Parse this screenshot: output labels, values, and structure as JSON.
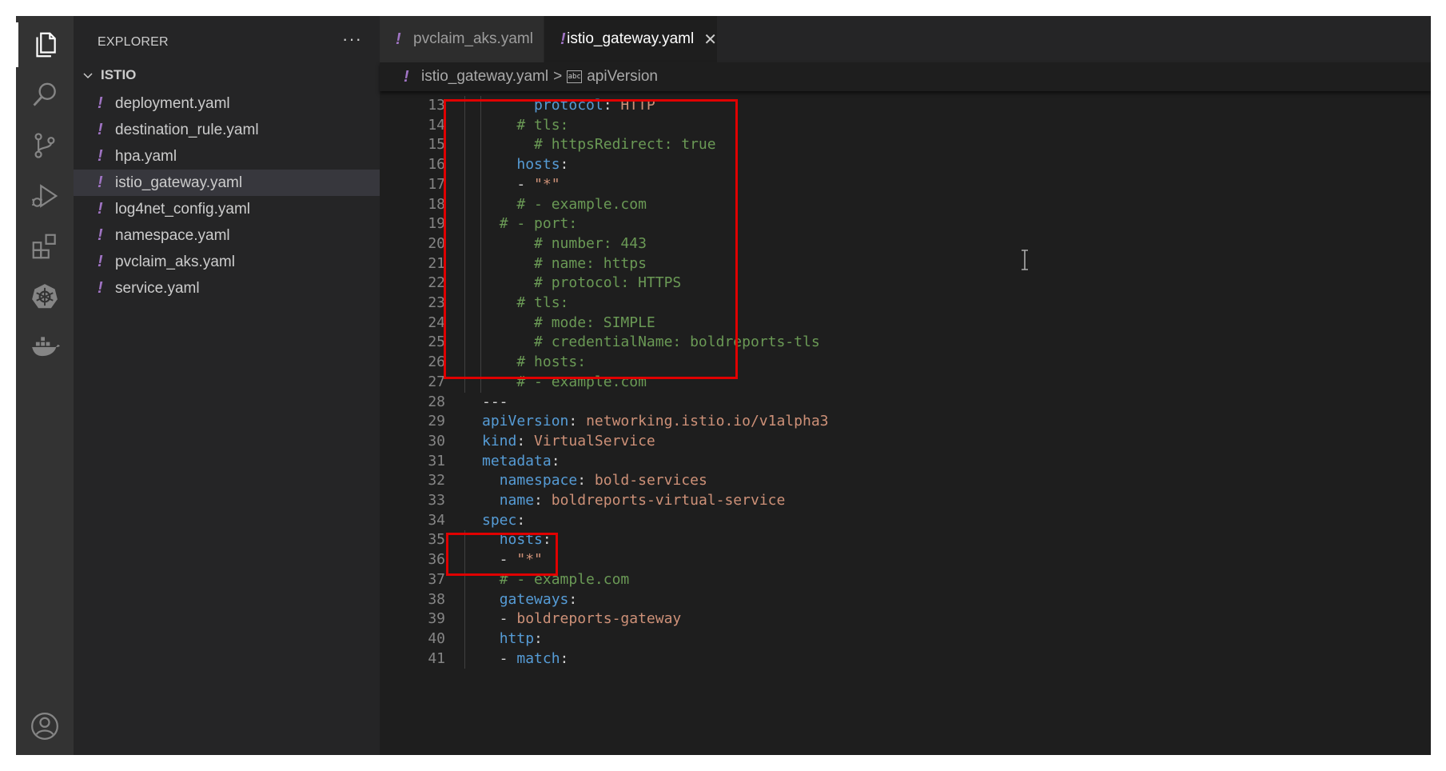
{
  "sidebar": {
    "title": "EXPLORER",
    "more": "···",
    "folder": "ISTIO",
    "files": [
      {
        "name": "deployment.yaml"
      },
      {
        "name": "destination_rule.yaml"
      },
      {
        "name": "hpa.yaml"
      },
      {
        "name": "istio_gateway.yaml",
        "selected": true
      },
      {
        "name": "log4net_config.yaml"
      },
      {
        "name": "namespace.yaml"
      },
      {
        "name": "pvclaim_aks.yaml"
      },
      {
        "name": "service.yaml"
      }
    ]
  },
  "activity_bar": [
    "files-icon",
    "search-icon",
    "source-control-icon",
    "run-debug-icon",
    "extensions-icon",
    "kubernetes-icon",
    "docker-icon",
    "account-icon"
  ],
  "tabs": [
    {
      "label": "pvclaim_aks.yaml",
      "active": false
    },
    {
      "label": "istio_gateway.yaml",
      "active": true,
      "close": "✕"
    }
  ],
  "breadcrumb": {
    "file": "istio_gateway.yaml",
    "separator": ">",
    "symbol_badge": "abc",
    "symbol": "apiVersion"
  },
  "file_icon_glyph": "!",
  "colors": {
    "keyword": "#569cd6",
    "string": "#ce9178",
    "comment": "#6a9955",
    "highlight_box": "#e00000",
    "yaml_icon": "#a074c4"
  },
  "editor": {
    "lines": [
      {
        "n": "13",
        "tokens": [
          [
            "p",
            "      "
          ],
          [
            "k",
            "protocol"
          ],
          [
            "p",
            ": "
          ],
          [
            "s",
            "HTTP"
          ]
        ]
      },
      {
        "n": "14",
        "tokens": [
          [
            "p",
            "    "
          ],
          [
            "c",
            "# tls:"
          ]
        ]
      },
      {
        "n": "15",
        "tokens": [
          [
            "p",
            "      "
          ],
          [
            "c",
            "# httpsRedirect: true"
          ]
        ]
      },
      {
        "n": "16",
        "tokens": [
          [
            "p",
            "    "
          ],
          [
            "k",
            "hosts"
          ],
          [
            "p",
            ":"
          ]
        ]
      },
      {
        "n": "17",
        "tokens": [
          [
            "p",
            "    - "
          ],
          [
            "s",
            "\"*\""
          ]
        ]
      },
      {
        "n": "18",
        "tokens": [
          [
            "p",
            "    "
          ],
          [
            "c",
            "# - example.com"
          ]
        ]
      },
      {
        "n": "19",
        "tokens": [
          [
            "p",
            "  "
          ],
          [
            "c",
            "# - port:"
          ]
        ]
      },
      {
        "n": "20",
        "tokens": [
          [
            "p",
            "      "
          ],
          [
            "c",
            "# number: 443"
          ]
        ]
      },
      {
        "n": "21",
        "tokens": [
          [
            "p",
            "      "
          ],
          [
            "c",
            "# name: https"
          ]
        ]
      },
      {
        "n": "22",
        "tokens": [
          [
            "p",
            "      "
          ],
          [
            "c",
            "# protocol: HTTPS"
          ]
        ]
      },
      {
        "n": "23",
        "tokens": [
          [
            "p",
            "    "
          ],
          [
            "c",
            "# tls:"
          ]
        ]
      },
      {
        "n": "24",
        "tokens": [
          [
            "p",
            "      "
          ],
          [
            "c",
            "# mode: SIMPLE"
          ]
        ]
      },
      {
        "n": "25",
        "tokens": [
          [
            "p",
            "      "
          ],
          [
            "c",
            "# credentialName: boldreports-tls"
          ]
        ]
      },
      {
        "n": "26",
        "tokens": [
          [
            "p",
            "    "
          ],
          [
            "c",
            "# hosts:"
          ]
        ]
      },
      {
        "n": "27",
        "tokens": [
          [
            "p",
            "    "
          ],
          [
            "c",
            "# - example.com"
          ]
        ]
      },
      {
        "n": "28",
        "tokens": [
          [
            "p",
            "---"
          ]
        ]
      },
      {
        "n": "29",
        "tokens": [
          [
            "k",
            "apiVersion"
          ],
          [
            "p",
            ": "
          ],
          [
            "s",
            "networking.istio.io/v1alpha3"
          ]
        ]
      },
      {
        "n": "30",
        "tokens": [
          [
            "k",
            "kind"
          ],
          [
            "p",
            ": "
          ],
          [
            "s",
            "VirtualService"
          ]
        ]
      },
      {
        "n": "31",
        "tokens": [
          [
            "k",
            "metadata"
          ],
          [
            "p",
            ":"
          ]
        ]
      },
      {
        "n": "32",
        "tokens": [
          [
            "p",
            "  "
          ],
          [
            "k",
            "namespace"
          ],
          [
            "p",
            ": "
          ],
          [
            "s",
            "bold-services"
          ]
        ]
      },
      {
        "n": "33",
        "tokens": [
          [
            "p",
            "  "
          ],
          [
            "k",
            "name"
          ],
          [
            "p",
            ": "
          ],
          [
            "s",
            "boldreports-virtual-service"
          ]
        ]
      },
      {
        "n": "34",
        "tokens": [
          [
            "k",
            "spec"
          ],
          [
            "p",
            ":"
          ]
        ]
      },
      {
        "n": "35",
        "tokens": [
          [
            "p",
            "  "
          ],
          [
            "k",
            "hosts"
          ],
          [
            "p",
            ":"
          ]
        ]
      },
      {
        "n": "36",
        "tokens": [
          [
            "p",
            "  - "
          ],
          [
            "s",
            "\"*\""
          ]
        ]
      },
      {
        "n": "37",
        "tokens": [
          [
            "p",
            "  "
          ],
          [
            "c",
            "# - example.com"
          ]
        ]
      },
      {
        "n": "38",
        "tokens": [
          [
            "p",
            "  "
          ],
          [
            "k",
            "gateways"
          ],
          [
            "p",
            ":"
          ]
        ]
      },
      {
        "n": "39",
        "tokens": [
          [
            "p",
            "  - "
          ],
          [
            "s",
            "boldreports-gateway"
          ]
        ]
      },
      {
        "n": "40",
        "tokens": [
          [
            "p",
            "  "
          ],
          [
            "k",
            "http"
          ],
          [
            "p",
            ":"
          ]
        ]
      },
      {
        "n": "41",
        "tokens": [
          [
            "p",
            "  - "
          ],
          [
            "k",
            "match"
          ],
          [
            "p",
            ":"
          ]
        ]
      }
    ]
  }
}
